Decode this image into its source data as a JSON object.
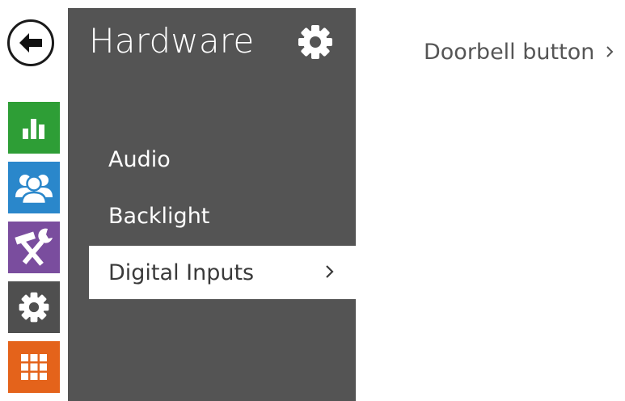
{
  "panel": {
    "title": "Hardware",
    "items": [
      {
        "label": "Audio"
      },
      {
        "label": "Backlight"
      },
      {
        "label": "Digital Inputs",
        "active": true
      }
    ]
  },
  "content": {
    "links": [
      {
        "label": "Doorbell button"
      }
    ]
  },
  "rail": {
    "items": [
      {
        "name": "status",
        "icon": "bar-chart-icon",
        "color": "#2e9e36"
      },
      {
        "name": "directory",
        "icon": "users-icon",
        "color": "#2a87cb"
      },
      {
        "name": "hardware",
        "icon": "tools-icon",
        "color": "#7a4d9e"
      },
      {
        "name": "system",
        "icon": "gear-icon",
        "color": "#4f4f4f"
      },
      {
        "name": "services",
        "icon": "grid-icon",
        "color": "#e4631b"
      }
    ]
  },
  "colors": {
    "panel_bg": "#545454",
    "active_item_bg": "#ffffff"
  }
}
